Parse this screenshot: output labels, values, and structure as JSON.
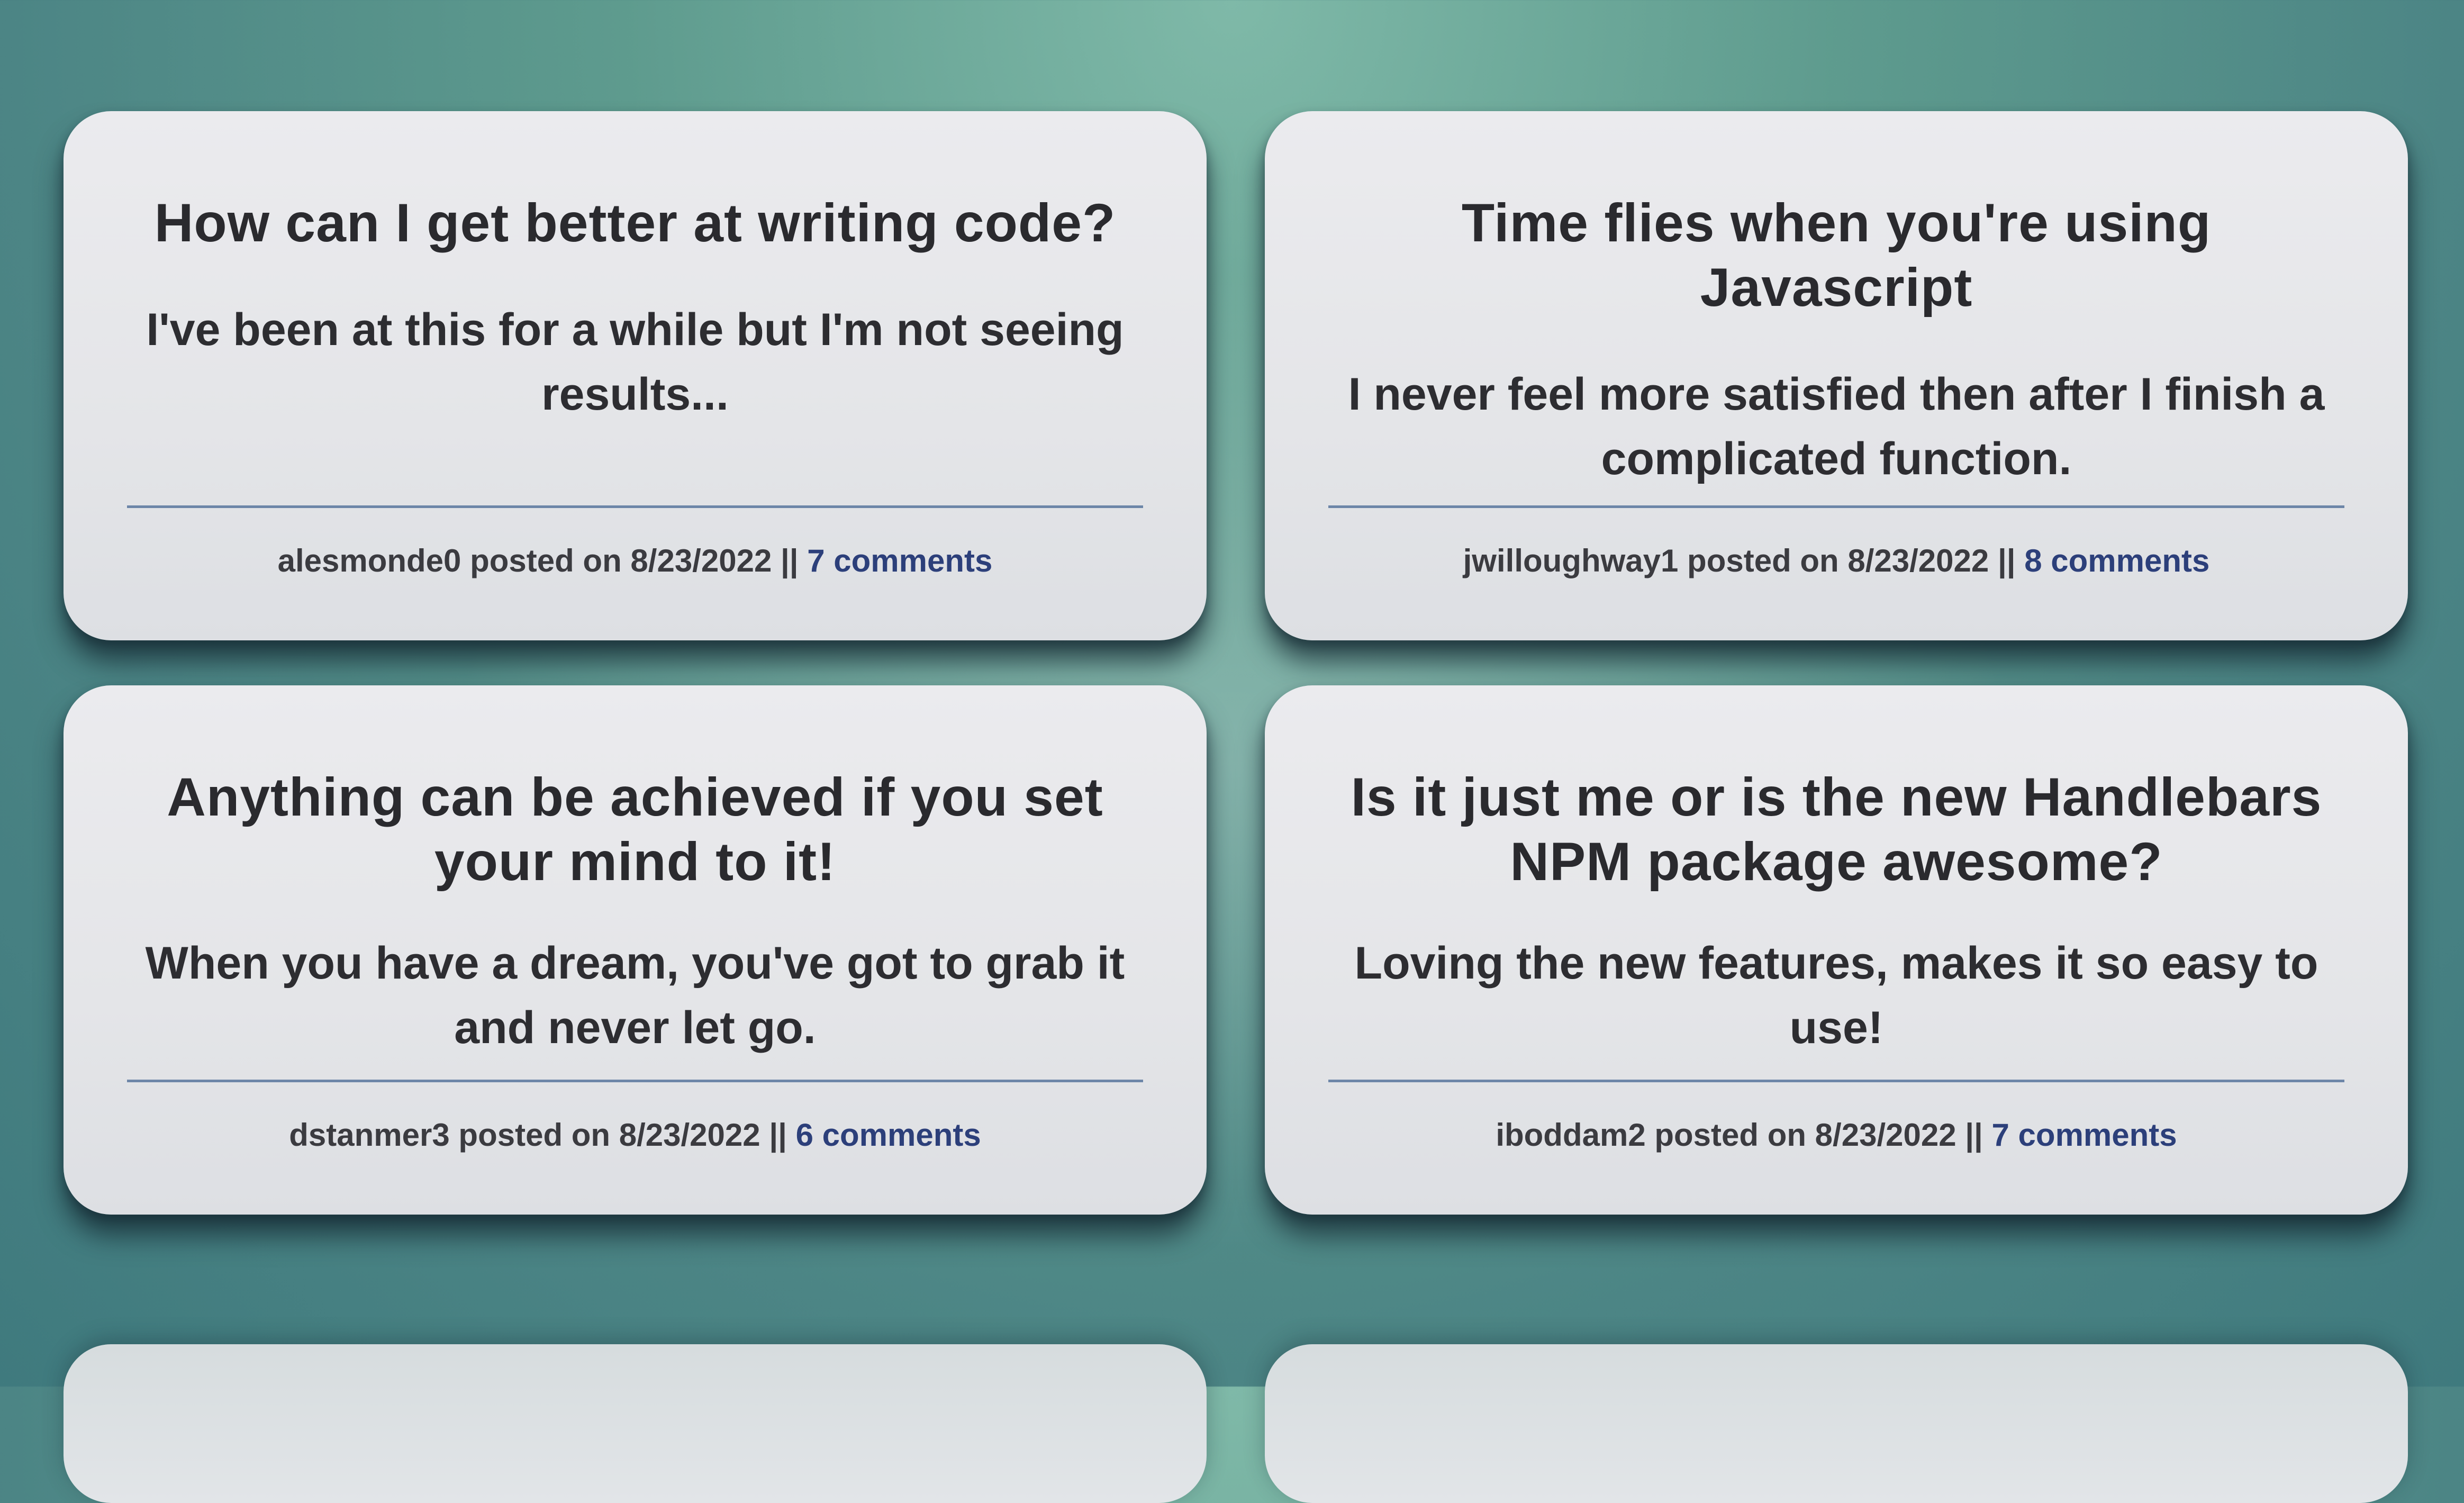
{
  "posts": [
    {
      "title": "How can I get better at writing code?",
      "body": "I've been at this for a while but I'm not seeing results...",
      "author": "alesmonde0",
      "posted_text": "posted on 8/23/2022 ||",
      "comments": "7 comments"
    },
    {
      "title": "Time flies when you're using Javascript",
      "body": "I never feel more satisfied then after I finish a complicated function.",
      "author": "jwilloughway1",
      "posted_text": "posted on 8/23/2022 ||",
      "comments": "8 comments"
    },
    {
      "title": "Anything can be achieved if you set your mind to it!",
      "body": "When you have a dream, you've got to grab it and never let go.",
      "author": "dstanmer3",
      "posted_text": "posted on 8/23/2022 ||",
      "comments": "6 comments"
    },
    {
      "title": "Is it just me or is the new Handlebars NPM package awesome?",
      "body": "Loving the new features, makes it so easy to use!",
      "author": "iboddam2",
      "posted_text": "posted on 8/23/2022 ||",
      "comments": "7 comments"
    }
  ],
  "colors": {
    "background": "#5e9b8e",
    "card": "#e6e7ea",
    "text": "#2a2a2e",
    "link": "#2c3f7a",
    "divider": "#6d86a8"
  }
}
